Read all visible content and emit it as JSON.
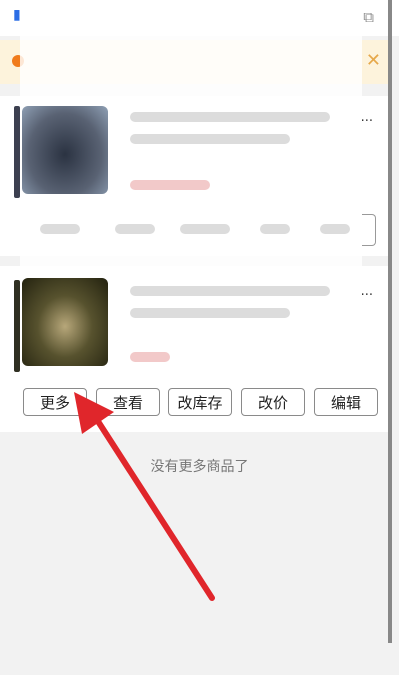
{
  "colors": {
    "arrow": "#e0262b",
    "notice_bg": "#fdf3dc",
    "notice_dot": "#f07b1b",
    "link_blue": "#2b6de5"
  },
  "header": {
    "left_icon": "blue-text-glyph",
    "right_icon": "copy-icon"
  },
  "notice": {
    "icon": "warning-dot-icon",
    "close_icon": "close-icon"
  },
  "products": [
    {
      "ellipsis": "..."
    },
    {
      "ellipsis": "..."
    }
  ],
  "actions": {
    "more": "更多",
    "view": "查看",
    "stock": "改库存",
    "price": "改价",
    "edit": "编辑"
  },
  "footer": {
    "no_more": "没有更多商品了"
  }
}
